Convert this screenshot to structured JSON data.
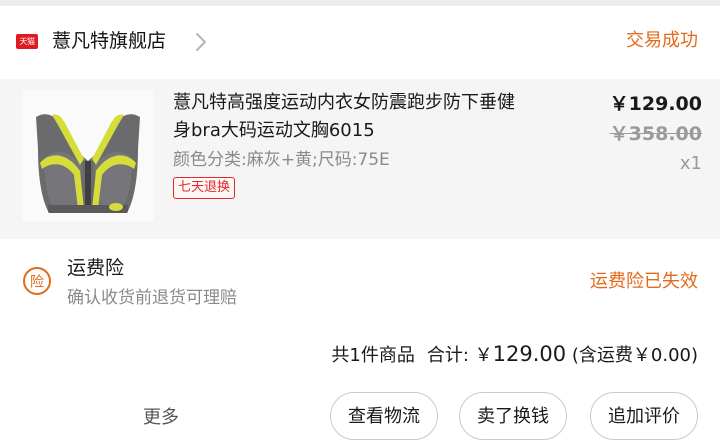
{
  "store": {
    "badge": "天猫",
    "name": "薏凡特旗舰店",
    "status": "交易成功"
  },
  "product": {
    "title_line1": "薏凡特高强度运动内衣女防震跑步防下垂健",
    "title_line2": "身bra大码运动文胸6015",
    "spec": "颜色分类:麻灰+黄;尺码:75E",
    "tag": "七天退换",
    "price": "￥129.00",
    "original_price": "￥358.00",
    "quantity": "x1"
  },
  "insurance": {
    "icon_char": "险",
    "title": "运费险",
    "description": "确认收货前退货可理赔",
    "status": "运费险已失效"
  },
  "summary": {
    "item_count": "共1件商品",
    "total_label": "合计: ￥",
    "total_value": "129.00",
    "shipping": "(含运费￥0.00)"
  },
  "actions": {
    "more": "更多",
    "logistics": "查看物流",
    "resell": "卖了换钱",
    "review": "追加评价"
  },
  "colors": {
    "accent": "#e46a1a",
    "tmall_red": "#e01a22",
    "tag_red": "#e12b2b"
  }
}
